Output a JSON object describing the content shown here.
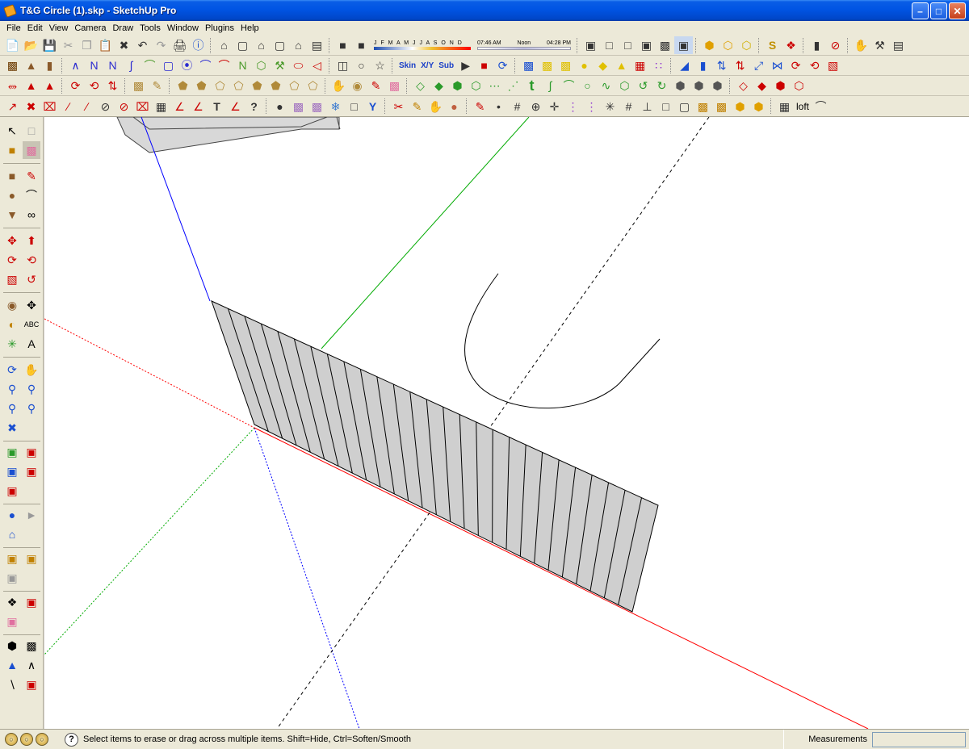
{
  "window": {
    "title": "T&G Circle (1).skp - SketchUp Pro",
    "minimize_icon": "minimize-icon",
    "maximize_icon": "maximize-icon",
    "close_icon": "close-icon"
  },
  "menu": [
    "File",
    "Edit",
    "View",
    "Camera",
    "Draw",
    "Tools",
    "Window",
    "Plugins",
    "Help"
  ],
  "shadows": {
    "months": "J F M A M J J A S O N D",
    "time_start": "07:46 AM",
    "time_mid": "Noon",
    "time_end": "04:28 PM"
  },
  "toolbar_texts": {
    "skin": "Skin",
    "xy": "X/Y",
    "sub": "Sub",
    "loft": "loft",
    "t_tool": "t"
  },
  "status": {
    "help_icon": "?",
    "message": "Select items to erase or drag across multiple items. Shift=Hide, Ctrl=Soften/Smooth",
    "measurements_label": "Measurements",
    "measurements_value": ""
  },
  "colors": {
    "axis_red": "#ff0000",
    "axis_green": "#00aa00",
    "axis_blue": "#0000ff",
    "face_gray": "#cfcfcf",
    "title_blue": "#0054e3"
  }
}
